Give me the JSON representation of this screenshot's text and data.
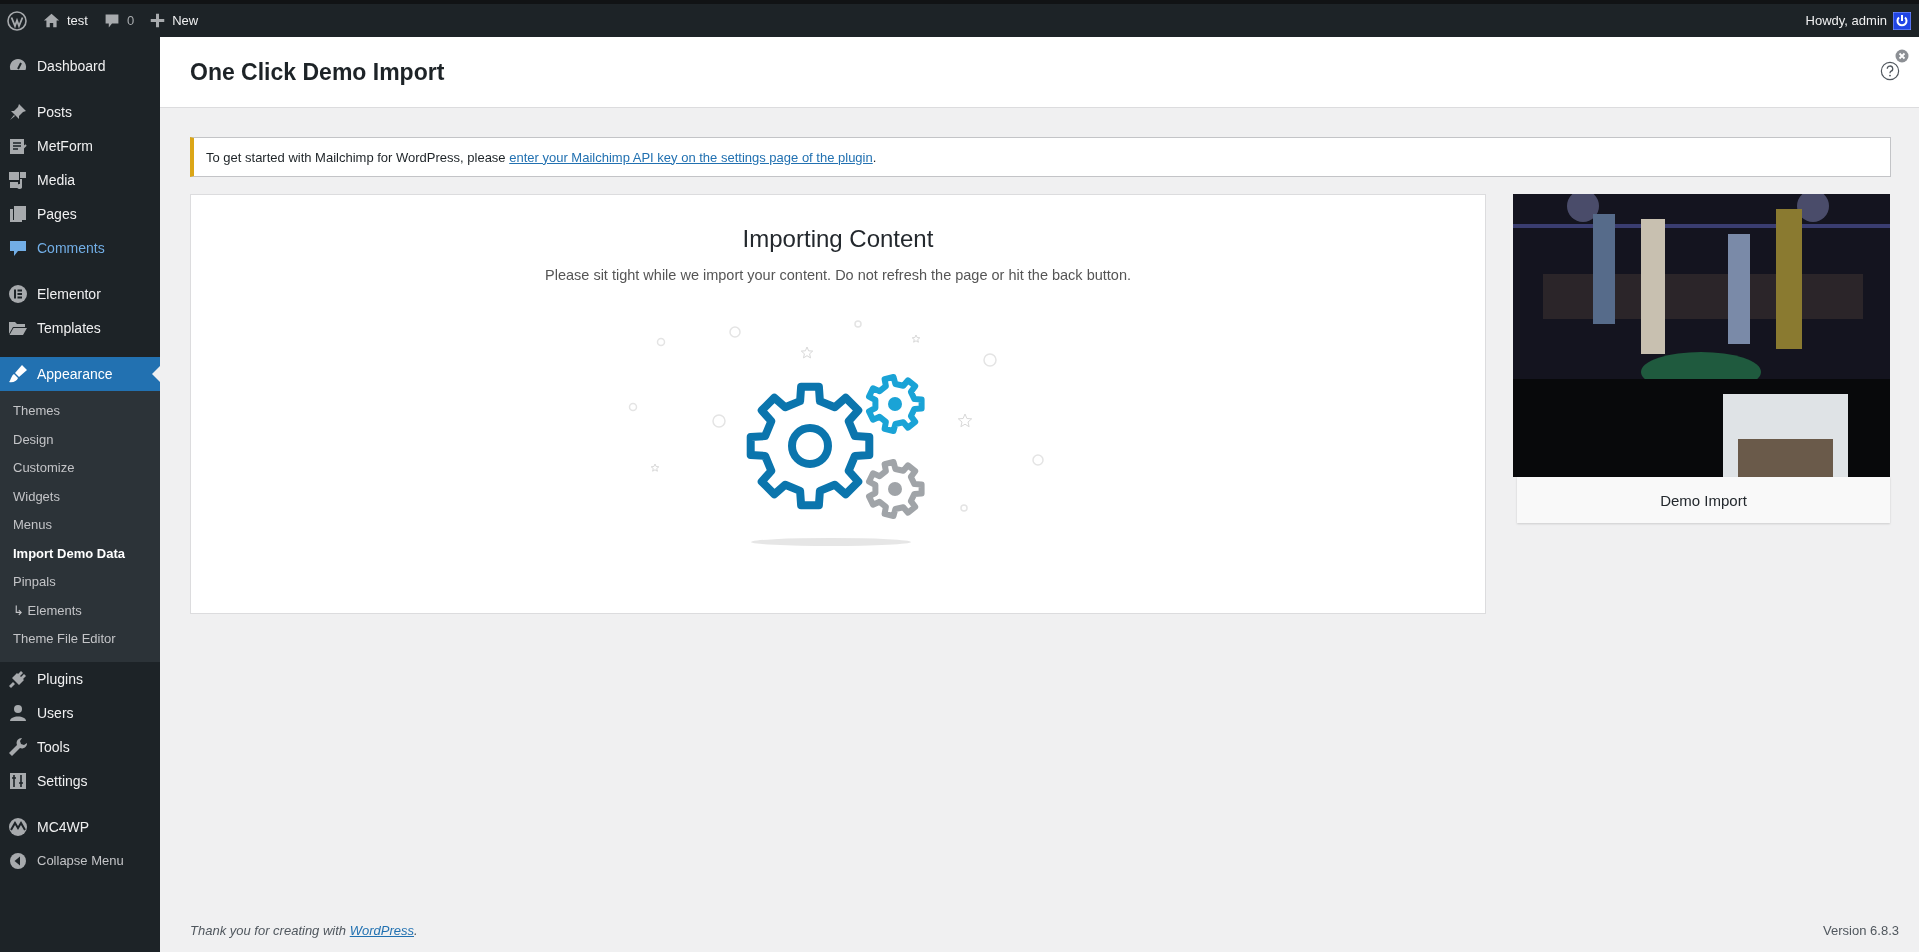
{
  "admin_bar": {
    "site": "test",
    "comments": "0",
    "new": "New",
    "greeting": "Howdy, admin"
  },
  "menu_groups": [
    [
      {
        "label": "Dashboard",
        "kind": "dashboard",
        "selected": false,
        "hovered": false
      }
    ],
    [
      {
        "label": "Posts",
        "kind": "pin",
        "selected": false,
        "hovered": false
      },
      {
        "label": "MetForm",
        "kind": "form",
        "selected": false,
        "hovered": false
      },
      {
        "label": "Media",
        "kind": "media",
        "selected": false,
        "hovered": false
      },
      {
        "label": "Pages",
        "kind": "pages",
        "selected": false,
        "hovered": false
      },
      {
        "label": "Comments",
        "kind": "comment",
        "selected": false,
        "hovered": true
      }
    ],
    [
      {
        "label": "Elementor",
        "kind": "elementor",
        "selected": false,
        "hovered": false
      },
      {
        "label": "Templates",
        "kind": "folder",
        "selected": false,
        "hovered": false
      }
    ],
    [
      {
        "label": "Appearance",
        "kind": "brush",
        "selected": true,
        "hovered": false,
        "expanded": true,
        "submenu": [
          {
            "label": "Themes",
            "selected": false
          },
          {
            "label": "Design",
            "selected": false
          },
          {
            "label": "Customize",
            "selected": false
          },
          {
            "label": "Widgets",
            "selected": false
          },
          {
            "label": "Menus",
            "selected": false
          },
          {
            "label": "Import Demo Data",
            "selected": true
          },
          {
            "label": "Pinpals",
            "selected": false
          },
          {
            "label": "↳ Elements",
            "selected": false
          },
          {
            "label": "Theme File Editor",
            "selected": false
          }
        ]
      },
      {
        "label": "Plugins",
        "kind": "plug",
        "selected": false,
        "hovered": false
      },
      {
        "label": "Users",
        "kind": "user",
        "selected": false,
        "hovered": false
      },
      {
        "label": "Tools",
        "kind": "wrench",
        "selected": false,
        "hovered": false
      },
      {
        "label": "Settings",
        "kind": "sliders",
        "selected": false,
        "hovered": false
      }
    ],
    [
      {
        "label": "MC4WP",
        "kind": "mc4wp",
        "selected": false,
        "hovered": false
      },
      {
        "label": "Collapse Menu",
        "kind": "collapse",
        "selected": false,
        "hovered": false
      }
    ]
  ],
  "page": {
    "title": "One Click Demo Import"
  },
  "notice": {
    "text": "To get started with Mailchimp for WordPress, please ",
    "link": "enter your Mailchimp API key on the settings page of the plugin",
    "after": "."
  },
  "import_panel": {
    "title": "Importing Content",
    "message": "Please sit tight while we import your content. Do not refresh the page or hit the back button."
  },
  "demo": {
    "kind": "picture",
    "caption": "Demo Import"
  },
  "footer": {
    "text": "Thank you for creating with ",
    "link": "WordPress",
    "after": ".",
    "version": "Version 6.8.3"
  }
}
